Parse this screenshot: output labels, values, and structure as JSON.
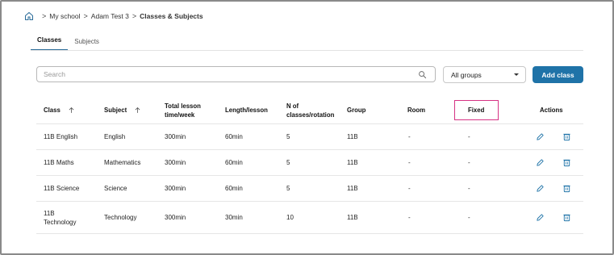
{
  "breadcrumb": {
    "items": [
      "My school",
      "Adam Test 3"
    ],
    "current": "Classes & Subjects",
    "separator": ">"
  },
  "tabs": [
    {
      "label": "Classes",
      "active": true
    },
    {
      "label": "Subjects",
      "active": false
    }
  ],
  "search": {
    "placeholder": "Search",
    "value": ""
  },
  "group_filter": {
    "selected": "All groups"
  },
  "add_button": {
    "label": "Add class"
  },
  "colors": {
    "accent": "#1f73a8",
    "highlight": "#d63384"
  },
  "table": {
    "headers": {
      "class": "Class",
      "subject": "Subject",
      "total_line1": "Total lesson",
      "total_line2": "time/week",
      "length": "Length/lesson",
      "nclasses_line1": "N of",
      "nclasses_line2": "classes/rotation",
      "group": "Group",
      "room": "Room",
      "fixed": "Fixed",
      "actions": "Actions"
    },
    "rows": [
      {
        "class": "11B English",
        "subject": "English",
        "total": "300min",
        "length": "60min",
        "nclasses": "5",
        "group": "11B",
        "room": "-",
        "fixed": "-"
      },
      {
        "class": "11B Maths",
        "subject": "Mathematics",
        "total": "300min",
        "length": "60min",
        "nclasses": "5",
        "group": "11B",
        "room": "-",
        "fixed": "-"
      },
      {
        "class": "11B Science",
        "subject": "Science",
        "total": "300min",
        "length": "60min",
        "nclasses": "5",
        "group": "11B",
        "room": "-",
        "fixed": "-"
      },
      {
        "class_line1": "11B",
        "class_line2": "Technology",
        "subject": "Technology",
        "total": "300min",
        "length": "30min",
        "nclasses": "10",
        "group": "11B",
        "room": "-",
        "fixed": "-"
      }
    ]
  }
}
